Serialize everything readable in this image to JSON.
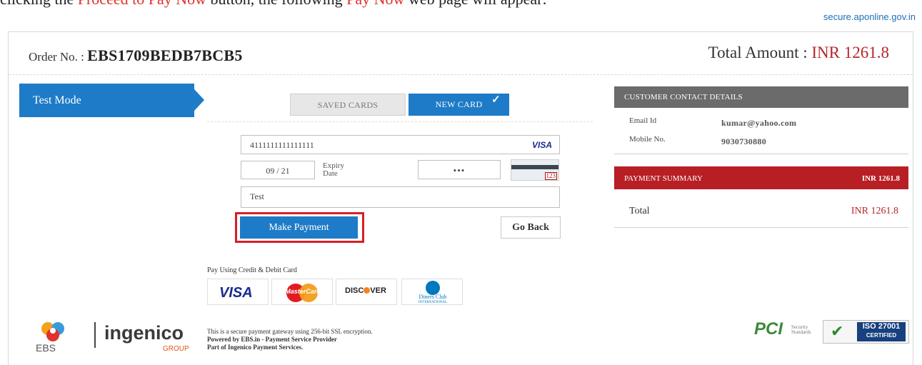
{
  "caption": {
    "prefix": "clicking the ",
    "highlight1": "Proceed to Pay Now",
    "middle": " button, the following ",
    "highlight2": "Pay Now",
    "suffix": " web page will appear:"
  },
  "domain": "secure.aponline.gov.in",
  "order": {
    "label": "Order No. : ",
    "number": "EBS1709BEDB7BCB5",
    "total_label": "Total Amount : ",
    "total_value": "INR 1261.8"
  },
  "mode": {
    "label": "Test Mode"
  },
  "tabs": {
    "saved": "SAVED CARDS",
    "new": "NEW CARD"
  },
  "form": {
    "card_number": "4111111111111111",
    "card_brand": "VISA",
    "expiry_month": "09",
    "expiry_sep": " / ",
    "expiry_year": "21",
    "expiry_label_1": "Expiry",
    "expiry_label_2": "Date",
    "cvv": "•••",
    "cvv_icon_text": "123",
    "name": "Test"
  },
  "buttons": {
    "pay": "Make Payment",
    "back": "Go Back"
  },
  "cards": {
    "heading": "Pay Using Credit & Debit Card",
    "visa": "VISA",
    "mastercard": "MasterCard",
    "discover_1": "DISC",
    "discover_2": "VER",
    "diners_1": "Diners Club",
    "diners_2": "INTERNATIONAL"
  },
  "customer": {
    "heading": "CUSTOMER CONTACT DETAILS",
    "email_label": "Email Id",
    "email_value": "kumar@yahoo.com",
    "mobile_label": "Mobile No.",
    "mobile_value": "9030730880"
  },
  "summary": {
    "heading": "PAYMENT SUMMARY",
    "heading_amount": "INR 1261.8",
    "total_label": "Total",
    "total_value": "INR 1261.8"
  },
  "footer": {
    "ebs": "EBS",
    "ingenico": "ingenico",
    "ingenico_sub": "GROUP",
    "line1": "This is a secure payment gateway using 256-bit SSL encryption.",
    "line2": "Powered by EBS.in - Payment Service Provider",
    "line3": "Part of Ingenico Payment Services.",
    "pci": "PCI",
    "pci_sub_1": "Security",
    "pci_sub_2": "Standards",
    "iso_1": "ISO 27001",
    "iso_2": "CERTIFIED"
  },
  "colors": {
    "brand_blue": "#1e7bc7",
    "summary_red": "#b71f24",
    "amount_red": "#b5262b",
    "highlight_red": "#d61f26"
  }
}
